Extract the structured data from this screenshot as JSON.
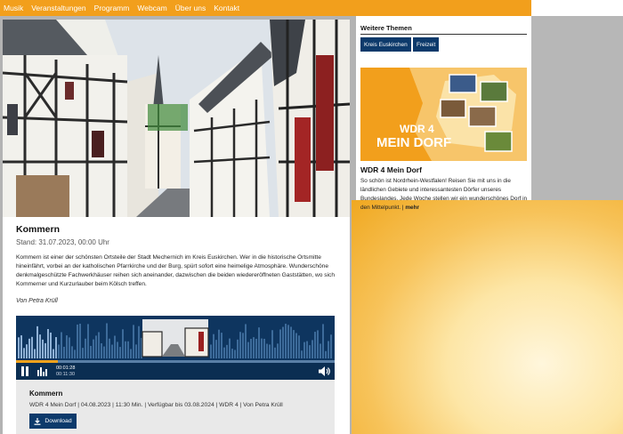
{
  "nav": {
    "items": [
      "Musik",
      "Veranstaltungen",
      "Programm",
      "Webcam",
      "Über uns",
      "Kontakt"
    ]
  },
  "article": {
    "title": "Kommern",
    "date": "Stand: 31.07.2023, 00:00 Uhr",
    "body": "Kommern ist einer der schönsten Ortsteile der Stadt Mechernich im Kreis Euskirchen. Wer in die historische Ortsmitte hineinfährt, vorbei an der katholischen Pfarrkirche und der Burg, spürt sofort eine heimelige Atmosphäre. Wunderschöne denkmalgeschützte Fachwerkhäuser reihen sich aneinander, dazwischen die beiden wiedereröffneten Gaststätten, wo sich Kommerner und Kurzurlauber beim Kölsch treffen.",
    "author": "Von Petra Krüll"
  },
  "player": {
    "current_time": "00:01:28",
    "total_time": "00:11:30",
    "progress": 0.13,
    "title": "Kommern",
    "meta": "WDR 4 Mein Dorf | 04.08.2023 | 11:30 Min. | Verfügbar bis 03.08.2024 | WDR 4 | Von Petra Krüll",
    "download_label": "Download"
  },
  "sidebar": {
    "heading": "Weitere Themen",
    "tags": [
      "Kreis Euskirchen",
      "Freizeit"
    ],
    "teaser_logo_line1": "WDR 4",
    "teaser_logo_line2": "MEIN DORF",
    "teaser_title": "WDR 4 Mein Dorf",
    "teaser_text": "So schön ist Nordrhein-Westfalen! Reisen Sie mit uns in die ländlichen Gebiete und interessantesten Dörfer unseres Bundeslandes. Jede Woche stellen wir ein wunderschönes Dorf in den Mittelpunkt.",
    "teaser_sep": " | ",
    "teaser_more": "mehr"
  },
  "colors": {
    "brand_orange": "#f29f1c",
    "brand_blue": "#0d3a6b"
  }
}
